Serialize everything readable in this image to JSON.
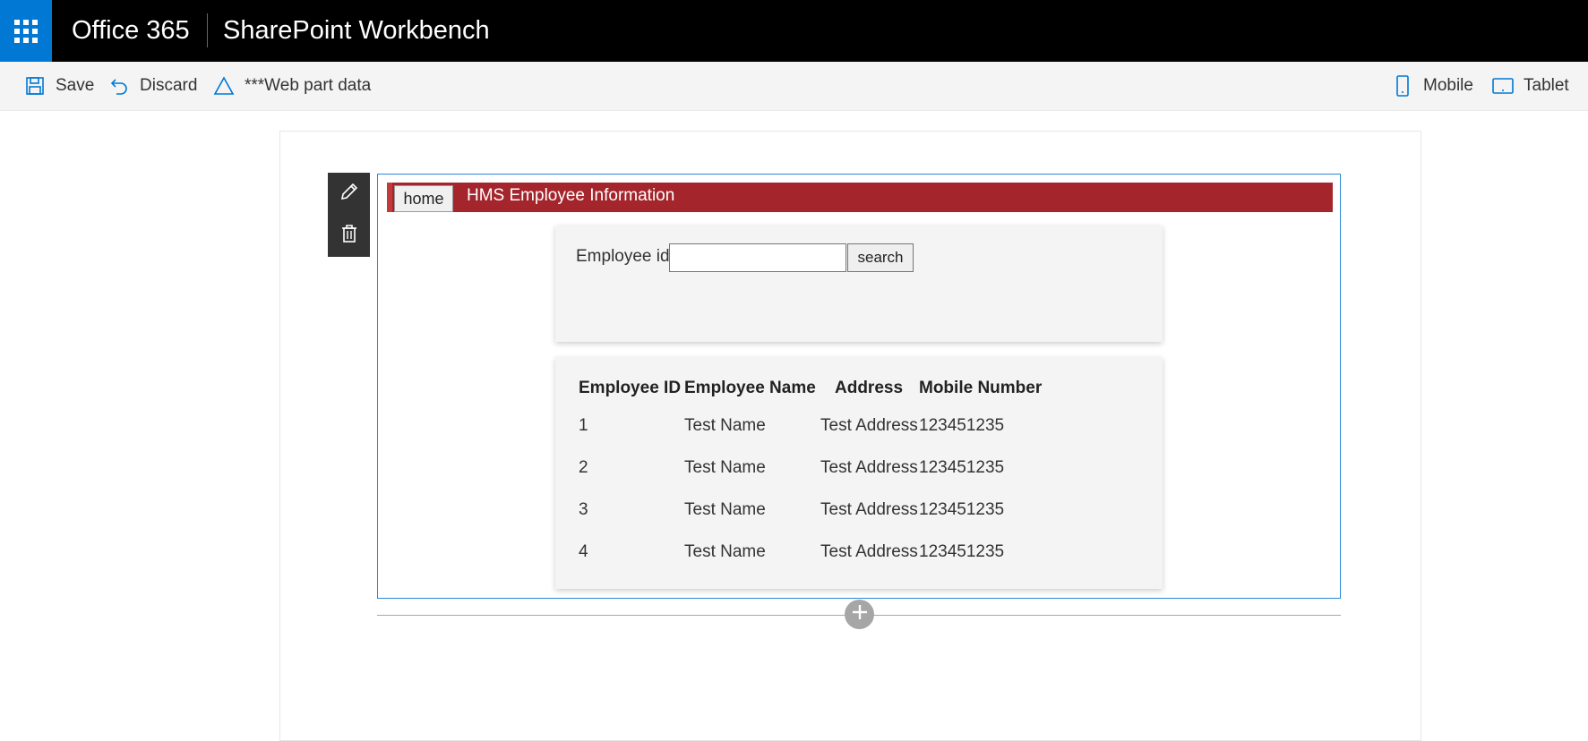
{
  "suite_bar": {
    "brand": "Office 365",
    "app_title": "SharePoint Workbench",
    "accent_color": "#0078d4"
  },
  "command_bar": {
    "save_label": "Save",
    "discard_label": "Discard",
    "web_part_data_label": "***Web part data",
    "mobile_label": "Mobile",
    "tablet_label": "Tablet"
  },
  "web_part": {
    "home_label": "home",
    "title": "HMS Employee Information",
    "header_color": "#a4262c",
    "search": {
      "label": "Employee id",
      "input_value": "",
      "button_label": "search"
    },
    "table": {
      "headers": [
        "Employee ID",
        "Employee Name",
        "Address",
        "Mobile Number"
      ],
      "rows": [
        [
          "1",
          "Test Name",
          "Test Address",
          "123451235"
        ],
        [
          "2",
          "Test Name",
          "Test Address",
          "123451235"
        ],
        [
          "3",
          "Test Name",
          "Test Address",
          "123451235"
        ],
        [
          "4",
          "Test Name",
          "Test Address",
          "123451235"
        ]
      ]
    }
  }
}
